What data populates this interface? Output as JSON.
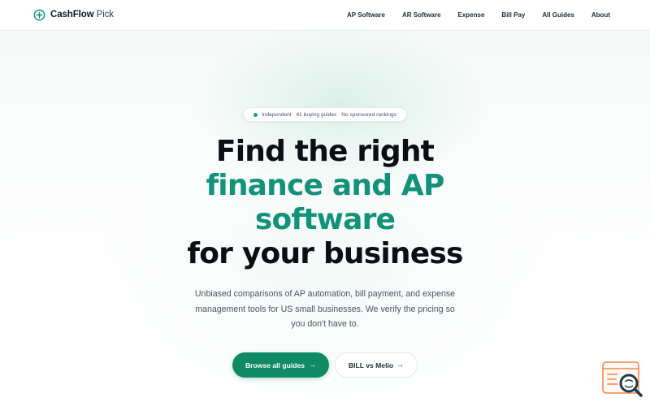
{
  "brand": {
    "name_bold": "CashFlow",
    "name_light": "Pick",
    "icon": "plus-circle-icon",
    "accent_color": "#11927a"
  },
  "nav": {
    "links": [
      "AP Software",
      "AR Software",
      "Expense",
      "Bill Pay",
      "All Guides",
      "About"
    ]
  },
  "hero": {
    "badge": "Independent · 41 buying guides · No sponsored rankings",
    "headline": {
      "line1": "Find the right",
      "line2": "finance and AP",
      "line3": "software",
      "line4": "for your business"
    },
    "subtitle": "Unbiased comparisons of AP automation, bill payment, and expense management tools for US small businesses. We verify the pricing so you don't have to.",
    "primary_cta": "Browse all guides",
    "secondary_cta": "BILL vs Melio"
  },
  "icons": {
    "cta_arrow": "→",
    "floating_widget": "search-chat-icon"
  },
  "colors": {
    "primary_button": "#0f8a63",
    "badge_dot": "#16a37a",
    "headline_dark": "#0b0f14",
    "widget_orange": "#f08a4b"
  }
}
